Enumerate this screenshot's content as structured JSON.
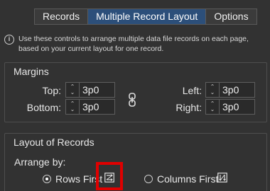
{
  "tabs": [
    {
      "label": "Records",
      "active": false
    },
    {
      "label": "Multiple Record Layout",
      "active": true
    },
    {
      "label": "Options",
      "active": false
    }
  ],
  "info": {
    "icon": "info-icon",
    "text_line1": "Use these controls to arrange multiple data file records on each page,",
    "text_line2": "based on your current layout for one record."
  },
  "margins": {
    "title": "Margins",
    "top": {
      "label": "Top:",
      "value": "3p0"
    },
    "bottom": {
      "label": "Bottom:",
      "value": "3p0"
    },
    "left": {
      "label": "Left:",
      "value": "3p0"
    },
    "right": {
      "label": "Right:",
      "value": "3p0"
    },
    "link_icon": "chain-link-icon"
  },
  "layout": {
    "title": "Layout of Records",
    "arrange_label": "Arrange by:",
    "rows_first": {
      "label": "Rows First",
      "selected": true,
      "icon": "rows-first-icon"
    },
    "columns_first": {
      "label": "Columns First",
      "selected": false,
      "icon": "columns-first-icon"
    }
  },
  "colors": {
    "background": "#323232",
    "active_tab": "#2c4f7a",
    "highlight": "#e00000"
  }
}
